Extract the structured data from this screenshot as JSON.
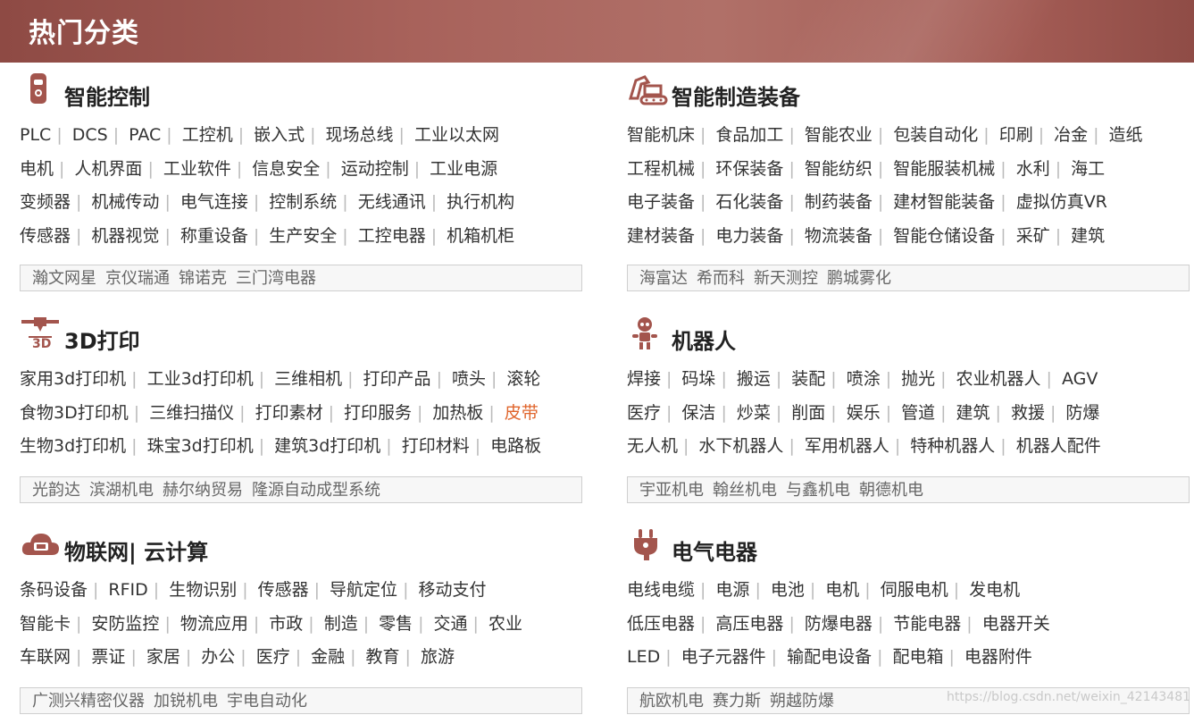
{
  "header": {
    "title": "热门分类"
  },
  "sections": [
    {
      "icon": "remote-control-icon",
      "title": "智能控制",
      "rows": [
        [
          "PLC",
          "DCS",
          "PAC",
          "工控机",
          "嵌入式",
          "现场总线",
          "工业以太网"
        ],
        [
          "电机",
          "人机界面",
          "工业软件",
          "信息安全",
          "运动控制",
          "工业电源"
        ],
        [
          "变频器",
          "机械传动",
          "电气连接",
          "控制系统",
          "无线通讯",
          "执行机构"
        ],
        [
          "传感器",
          "机器视觉",
          "称重设备",
          "生产安全",
          "工控电器",
          "机箱机柜"
        ]
      ],
      "brands": [
        "瀚文网星",
        "京仪瑞通",
        "锦诺克",
        "三门湾电器"
      ]
    },
    {
      "icon": "excavator-icon",
      "title": "智能制造装备",
      "rows": [
        [
          "智能机床",
          "食品加工",
          "智能农业",
          "包装自动化",
          "印刷",
          "冶金",
          "造纸"
        ],
        [
          "工程机械",
          "环保装备",
          "智能纺织",
          "智能服装机械",
          "水利",
          "海工"
        ],
        [
          "电子装备",
          "石化装备",
          "制药装备",
          "建材智能装备",
          "虚拟仿真VR"
        ],
        [
          "建材装备",
          "电力装备",
          "物流装备",
          "智能仓储设备",
          "采矿",
          "建筑"
        ]
      ],
      "brands": [
        "海富达",
        "希而科",
        "新天测控",
        "鹏城雾化"
      ]
    },
    {
      "icon": "3d-printer-icon",
      "title": "3D打印",
      "rows": [
        [
          "家用3d打印机",
          "工业3d打印机",
          "三维相机",
          "打印产品",
          "喷头",
          "滚轮"
        ],
        [
          "食物3D打印机",
          "三维扫描仪",
          "打印素材",
          "打印服务",
          "加热板",
          "皮带"
        ],
        [
          "生物3d打印机",
          "珠宝3d打印机",
          "建筑3d打印机",
          "打印材料",
          "电路板"
        ]
      ],
      "highlight": "皮带",
      "brands": [
        "光韵达",
        "滨湖机电",
        "赫尔纳贸易",
        "隆源自动成型系统"
      ]
    },
    {
      "icon": "robot-icon",
      "title": "机器人",
      "rows": [
        [
          "焊接",
          "码垛",
          "搬运",
          "装配",
          "喷涂",
          "抛光",
          "农业机器人",
          "AGV"
        ],
        [
          "医疗",
          "保洁",
          "炒菜",
          "削面",
          "娱乐",
          "管道",
          "建筑",
          "救援",
          "防爆"
        ],
        [
          "无人机",
          "水下机器人",
          "军用机器人",
          "特种机器人",
          "机器人配件"
        ]
      ],
      "brands": [
        "宇亚机电",
        "翰丝机电",
        "与鑫机电",
        "朝德机电"
      ]
    },
    {
      "icon": "cloud-icon",
      "title": "物联网| 云计算",
      "rows": [
        [
          "条码设备",
          "RFID",
          "生物识别",
          "传感器",
          "导航定位",
          "移动支付"
        ],
        [
          "智能卡",
          "安防监控",
          "物流应用",
          "市政",
          "制造",
          "零售",
          "交通",
          "农业"
        ],
        [
          "车联网",
          "票证",
          "家居",
          "办公",
          "医疗",
          "金融",
          "教育",
          "旅游"
        ]
      ],
      "brands": [
        "广测兴精密仪器",
        "加锐机电",
        "宇电自动化"
      ]
    },
    {
      "icon": "plug-icon",
      "title": "电气电器",
      "rows": [
        [
          "电线电缆",
          "电源",
          "电池",
          "电机",
          "伺服电机",
          "发电机"
        ],
        [
          "低压电器",
          "高压电器",
          "防爆电器",
          "节能电器",
          "电器开关"
        ],
        [
          "LED",
          "电子元器件",
          "输配电设备",
          "配电箱",
          "电器附件"
        ]
      ],
      "brands": [
        "航欧机电",
        "赛力斯",
        "朔越防爆"
      ]
    }
  ],
  "watermark": "https://blog.csdn.net/weixin_42143481",
  "colors": {
    "banner": "#a45c55",
    "icon": "#a3554d",
    "highlight": "#e0652c"
  }
}
